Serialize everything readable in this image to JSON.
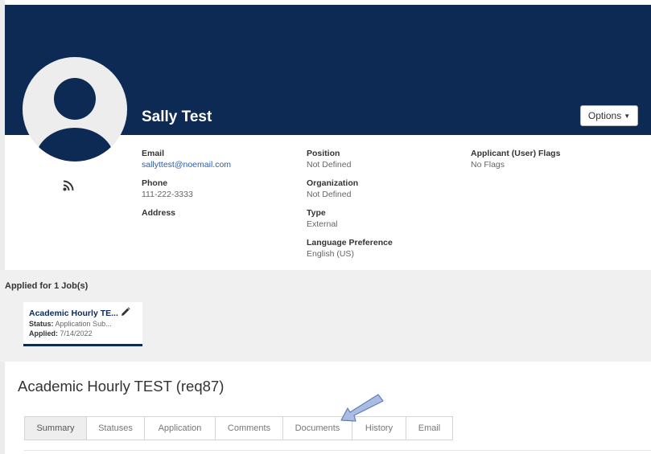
{
  "profile": {
    "name": "Sally Test",
    "options_label": "Options",
    "email_label": "Email",
    "email_value": "sallyttest@noemail.com",
    "phone_label": "Phone",
    "phone_value": "111-222-3333",
    "address_label": "Address",
    "position_label": "Position",
    "position_value": "Not Defined",
    "organization_label": "Organization",
    "organization_value": "Not Defined",
    "type_label": "Type",
    "type_value": "External",
    "language_label": "Language Preference",
    "language_value": "English (US)",
    "flags_label": "Applicant (User) Flags",
    "flags_value": "No Flags"
  },
  "applications": {
    "title": "Applied for 1 Job(s)",
    "card": {
      "title": "Academic Hourly TE...",
      "status_label": "Status:",
      "status_value": "Application Sub...",
      "applied_label": "Applied:",
      "applied_value": "7/14/2022"
    }
  },
  "requisition": {
    "title": "Academic Hourly TEST (req87)",
    "tabs": [
      {
        "label": "Summary"
      },
      {
        "label": "Statuses"
      },
      {
        "label": "Application"
      },
      {
        "label": "Comments"
      },
      {
        "label": "Documents"
      },
      {
        "label": "History"
      },
      {
        "label": "Email"
      }
    ],
    "active_tab": "Summary"
  },
  "colors": {
    "header": "#0c2a54",
    "link": "#2a5da8",
    "arrow": "#8fa9d6"
  },
  "icons": {
    "avatar": "user-avatar-icon",
    "rss": "rss-icon",
    "edit": "pencil-icon",
    "caret": "caret-down-icon",
    "pointer": "annotation-arrow-icon"
  }
}
